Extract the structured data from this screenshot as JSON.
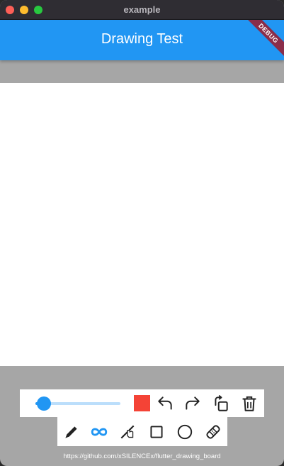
{
  "window": {
    "title": "example"
  },
  "appbar": {
    "title": "Drawing Test",
    "debug_banner": "DEBUG"
  },
  "toolbar": {
    "stroke_width_level": 0.1,
    "selected_color": "#f44336",
    "icons": [
      "undo-icon",
      "redo-icon",
      "rotate-icon",
      "delete-icon"
    ]
  },
  "tools": {
    "items": [
      "pen-icon",
      "smooth-line-icon",
      "straight-line-icon",
      "rectangle-icon",
      "circle-icon",
      "eraser-icon"
    ],
    "active": "smooth-line-icon",
    "accent_color": "#2196f3"
  },
  "footer": {
    "link": "https://github.com/xSILENCEx/flutter_drawing_board"
  }
}
